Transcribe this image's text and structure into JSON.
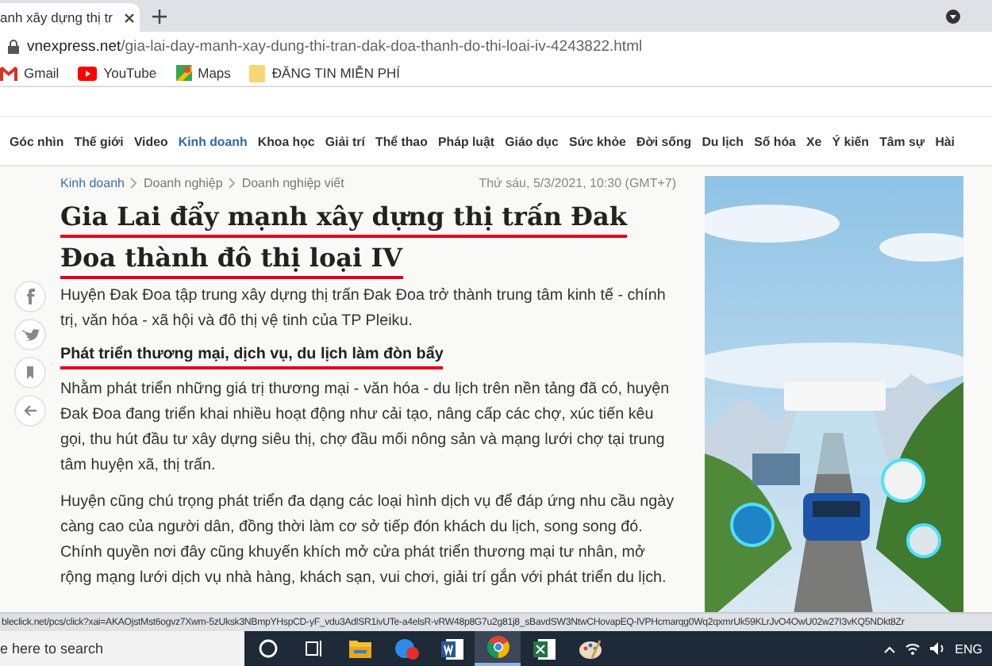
{
  "browser": {
    "tab_title": "anh xây dựng thị tr",
    "url_host": "vnexpress.net",
    "url_path": "/gia-lai-day-manh-xay-dung-thi-tran-dak-doa-thanh-do-thi-loai-iv-4243822.html",
    "bookmarks": [
      {
        "kind": "gmail",
        "label": "Gmail"
      },
      {
        "kind": "youtube",
        "label": "YouTube"
      },
      {
        "kind": "maps",
        "label": "Maps"
      },
      {
        "kind": "folder",
        "label": "ĐĂNG TIN MIỄN PHÍ"
      }
    ]
  },
  "nav": [
    {
      "label": "Góc nhìn",
      "selected": false
    },
    {
      "label": "Thế giới",
      "selected": false
    },
    {
      "label": "Video",
      "selected": false
    },
    {
      "label": "Kinh doanh",
      "selected": true
    },
    {
      "label": "Khoa học",
      "selected": false
    },
    {
      "label": "Giải trí",
      "selected": false
    },
    {
      "label": "Thể thao",
      "selected": false
    },
    {
      "label": "Pháp luật",
      "selected": false
    },
    {
      "label": "Giáo dục",
      "selected": false
    },
    {
      "label": "Sức khỏe",
      "selected": false
    },
    {
      "label": "Đời sống",
      "selected": false
    },
    {
      "label": "Du lịch",
      "selected": false
    },
    {
      "label": "Số hóa",
      "selected": false
    },
    {
      "label": "Xe",
      "selected": false
    },
    {
      "label": "Ý kiến",
      "selected": false
    },
    {
      "label": "Tâm sự",
      "selected": false
    },
    {
      "label": "Hài",
      "selected": false
    }
  ],
  "article": {
    "breadcrumb": [
      "Kinh doanh",
      "Doanh nghiệp",
      "Doanh nghiệp viết"
    ],
    "date": "Thứ sáu, 5/3/2021, 10:30 (GMT+7)",
    "title_lines": [
      "Gia Lai đẩy mạnh xây dựng thị trấn Đak",
      "Đoa thành đô thị loại IV"
    ],
    "lead": "Huyện Đak Đoa tập trung xây dựng thị trấn Đak Đoa trở thành trung tâm kinh tế - chính trị, văn hóa - xã hội và đô thị vệ tinh của TP Pleiku.",
    "subheading": "Phát triển thương mại, dịch vụ, du lịch làm đòn bẩy",
    "paragraphs": [
      "Nhằm phát triển những giá trị thương mại - văn hóa - du lịch trên nền tảng đã có, huyện Đak Đoa đang triển khai nhiều hoạt động như cải tạo, nâng cấp các chợ, xúc tiến kêu gọi, thu hút đầu tư xây dựng siêu thị, chợ đầu mối nông sản và mạng lưới chợ tại trung tâm huyện xã, thị trấn.",
      "Huyện cũng chú trọng phát triển đa dạng các loại hình dịch vụ để đáp ứng nhu cầu ngày càng cao của người dân, đồng thời làm cơ sở tiếp đón khách du lịch, song song đó. Chính quyền nơi đây cũng khuyến khích mở cửa phát triển thương mại tư nhân, mở rộng mạng lưới dịch vụ nhà hàng, khách sạn, vui chơi, giải trí gắn với phát triển du lịch."
    ]
  },
  "share": [
    {
      "kind": "facebook"
    },
    {
      "kind": "twitter"
    },
    {
      "kind": "bookmark"
    },
    {
      "kind": "back"
    }
  ],
  "status_url": "bleclick.net/pcs/click?xai=AKAOjstMst6ogvz7Xwm-5zUksk3NBmpYHspCD-yF_vdu3AdlSR1ivUTe-a4elsR-vRW48p8G7u2g81j8_sBavdSW3NtwCHovapEQ-lVPHcmarqg0Wq2qxmrUk59KLrJvO4OwU02w27I3vKQ5NDkt8Zr",
  "taskbar": {
    "search_placeholder": "e here to search",
    "apps": [
      {
        "kind": "cortana",
        "selected": false
      },
      {
        "kind": "taskview",
        "selected": false
      },
      {
        "kind": "explorer",
        "selected": false
      },
      {
        "kind": "skype",
        "selected": false
      },
      {
        "kind": "word",
        "selected": false
      },
      {
        "kind": "chrome",
        "selected": true
      },
      {
        "kind": "excel",
        "selected": false
      },
      {
        "kind": "paint",
        "selected": false
      }
    ],
    "language": "ENG"
  }
}
